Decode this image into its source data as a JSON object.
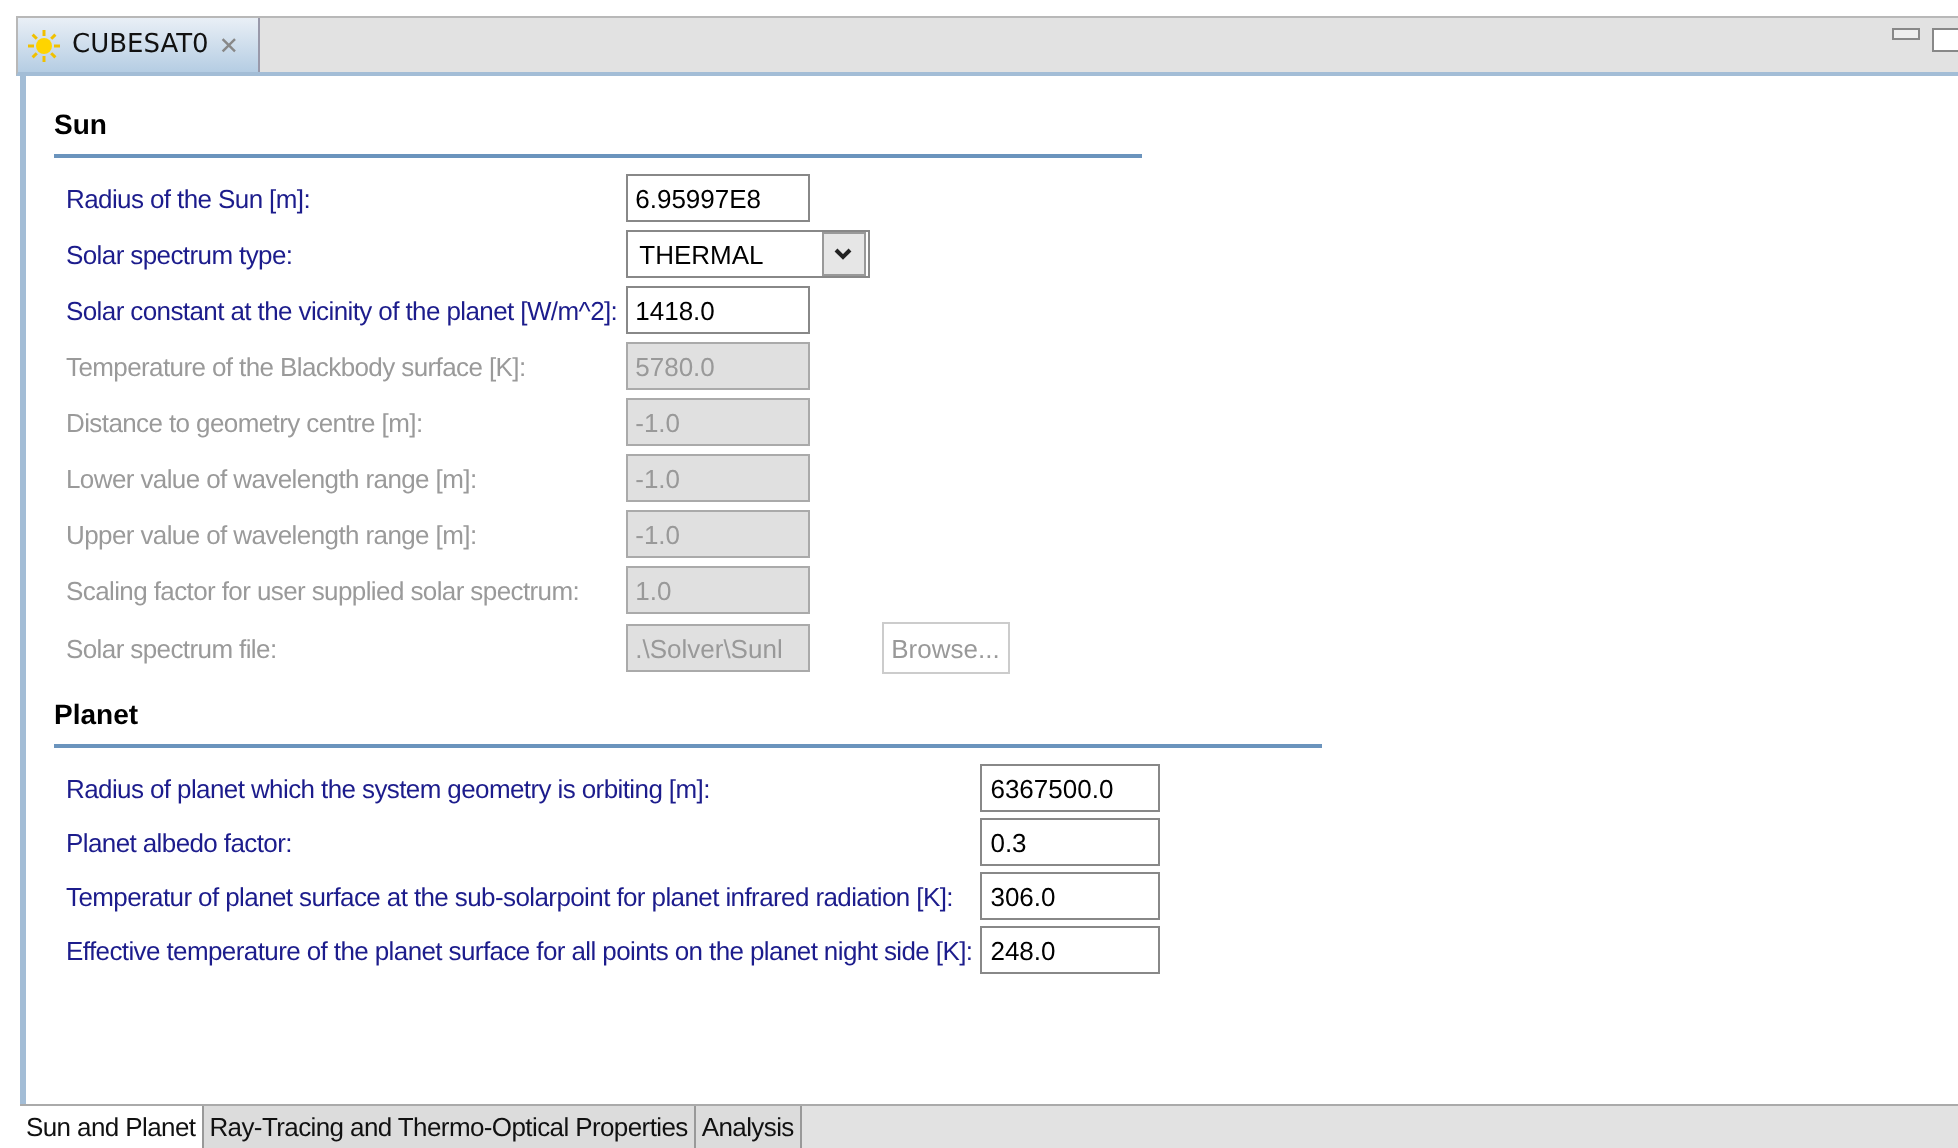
{
  "editor_tab": {
    "title": "CUBESAT0",
    "close": "✕"
  },
  "sections": [
    {
      "title": "Sun",
      "fields": [
        {
          "kind": "text",
          "label": "Radius of the Sun [m]:",
          "value": "6.95997E8",
          "disabled": false
        },
        {
          "kind": "select",
          "label": "Solar spectrum type:",
          "value": "THERMAL",
          "disabled": false
        },
        {
          "kind": "text",
          "label": "Solar constant at the vicinity of the planet [W/m^2]:",
          "value": "1418.0",
          "disabled": false
        },
        {
          "kind": "text",
          "label": "Temperature of the Blackbody surface [K]:",
          "value": "5780.0",
          "disabled": true
        },
        {
          "kind": "text",
          "label": "Distance to geometry centre [m]:",
          "value": "-1.0",
          "disabled": true
        },
        {
          "kind": "text",
          "label": "Lower value of wavelength range [m]:",
          "value": "-1.0",
          "disabled": true
        },
        {
          "kind": "text",
          "label": "Upper value of wavelength range [m]:",
          "value": "-1.0",
          "disabled": true
        },
        {
          "kind": "text",
          "label": "Scaling factor for user supplied solar spectrum:",
          "value": "1.0",
          "disabled": true
        },
        {
          "kind": "file",
          "label": "Solar spectrum file:",
          "value": ".\\Solver\\Sunl",
          "disabled": true,
          "button": "Browse..."
        }
      ]
    },
    {
      "title": "Planet",
      "fields": [
        {
          "kind": "text",
          "label": "Radius of planet which the system geometry is orbiting [m]:",
          "value": "6367500.0",
          "disabled": false
        },
        {
          "kind": "text",
          "label": "Planet albedo factor:",
          "value": "0.3",
          "disabled": false
        },
        {
          "kind": "text",
          "label": "Temperatur of planet surface at the sub-solarpoint for planet infrared radiation [K]:",
          "value": "306.0",
          "disabled": false
        },
        {
          "kind": "text",
          "label": "Effective temperature of the planet surface for all points on the planet night side [K]:",
          "value": "248.0",
          "disabled": false
        }
      ]
    }
  ],
  "bottom_tabs": [
    {
      "label": "Sun and Planet",
      "selected": true
    },
    {
      "label": "Ray-Tracing and Thermo-Optical Properties",
      "selected": false
    },
    {
      "label": "Analysis",
      "selected": false
    }
  ]
}
